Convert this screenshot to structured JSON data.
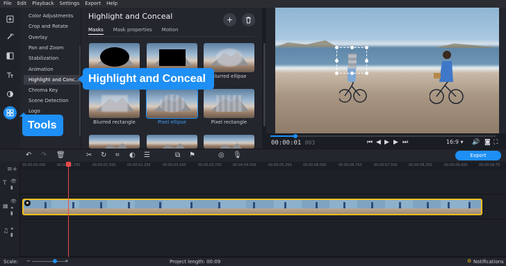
{
  "menu": [
    "File",
    "Edit",
    "Playback",
    "Settings",
    "Export",
    "Help"
  ],
  "toolbar": {
    "icons": [
      "import-icon",
      "magic-wand-icon",
      "transitions-icon",
      "titles-icon",
      "filters-icon",
      "more-tools-icon"
    ]
  },
  "tools": {
    "items": [
      "Color Adjustments",
      "Crop and Rotate",
      "Overlay",
      "Pan and Zoom",
      "Stabilization",
      "Animation",
      "Highlight and Conc...",
      "Chroma Key",
      "Scene Detection",
      "Logo"
    ],
    "selected_index": 6
  },
  "callouts": {
    "highlight": "Highlight and Conceal",
    "tools": "Tools"
  },
  "panel": {
    "title": "Highlight and Conceal",
    "add_symbol": "+",
    "tabs": [
      "Masks",
      "Mask properties",
      "Motion"
    ],
    "active_tab": "Masks",
    "masks": [
      {
        "label": "",
        "kind": "black-ellipse"
      },
      {
        "label": "",
        "kind": "black-rectangle"
      },
      {
        "label": "Blurred ellipse",
        "kind": "blurred-ellipse"
      },
      {
        "label": "Blurred rectangle",
        "kind": "blurred-rectangle"
      },
      {
        "label": "Pixel ellipse",
        "kind": "pixel-ellipse",
        "selected": true
      },
      {
        "label": "Pixel rectangle",
        "kind": "pixel-rectangle"
      }
    ]
  },
  "player": {
    "time_main": "00:00:01",
    "time_frames": "003",
    "aspect": "16:9",
    "progress": 0.11
  },
  "timeline": {
    "export_label": "Export",
    "ruler": [
      "00:00:00.000",
      "00:00:00.750",
      "00:00:01.500",
      "00:00:02.250",
      "00:00:03.000",
      "00:00:03.750",
      "00:00:04.500",
      "00:00:05.250",
      "00:00:06.000",
      "00:00:06.750",
      "00:00:07.500",
      "00:00:08.250",
      "00:00:09.000",
      "00:00:09.75"
    ]
  },
  "status": {
    "scale_label": "Scale:",
    "project_length": "Project length: 00:09",
    "notifications": "Notifications"
  },
  "colors": {
    "accent": "#1e8ff5",
    "clip_border": "#f0c020",
    "playhead": "#e84a4a"
  }
}
